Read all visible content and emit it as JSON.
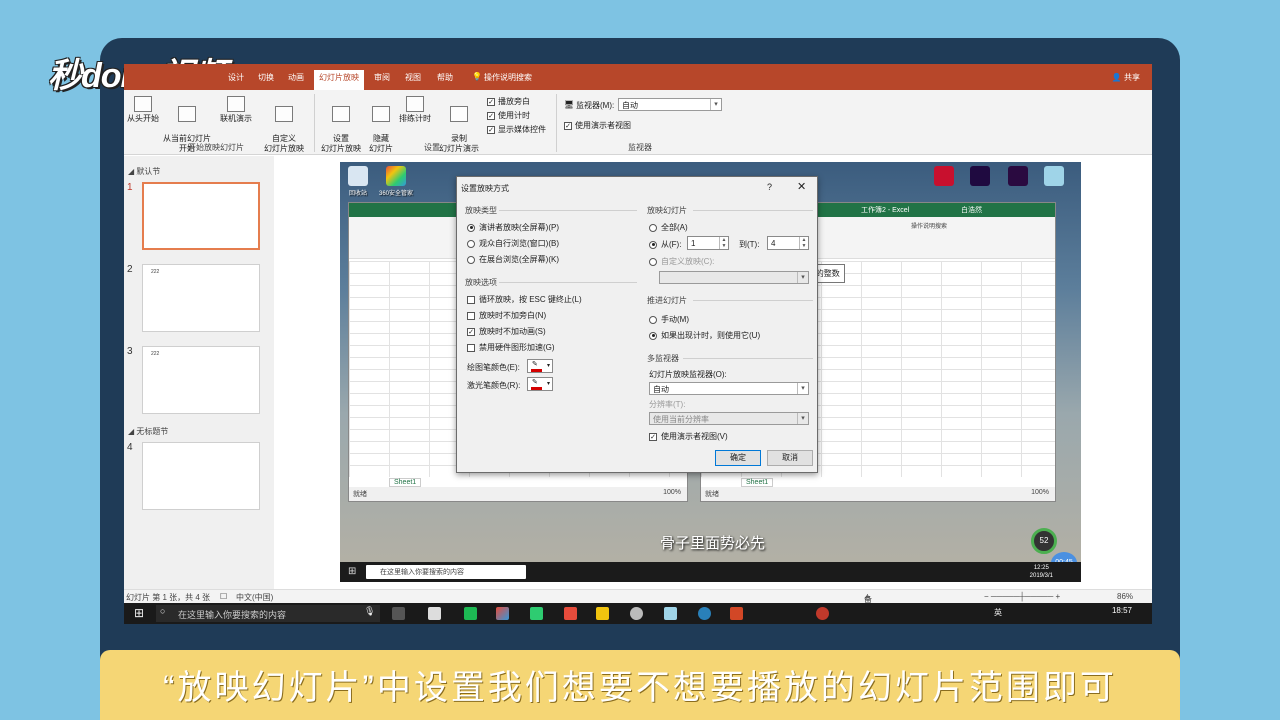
{
  "brand": {
    "logo_text": "秒dong视频"
  },
  "ribbon": {
    "tabs": [
      "设计",
      "切换",
      "动画",
      "幻灯片放映",
      "审阅",
      "视图",
      "帮助",
      "操作说明搜索"
    ],
    "share": "共享",
    "buttons": {
      "from_start": "从头开始",
      "from_current": "从当前幻灯片\n开始",
      "online": "联机演示",
      "custom": "自定义\n幻灯片放映",
      "setup": "设置\n幻灯片放映",
      "hide": "隐藏\n幻灯片",
      "rehearse": "排练计时",
      "record": "录制\n幻灯片演示"
    },
    "checks": [
      "播放旁白",
      "使用计时",
      "显示媒体控件"
    ],
    "monitor_label": "监视器(M):",
    "monitor_value": "自动",
    "presenter_view": "使用演示者视图",
    "groups": [
      "开始放映幻灯片",
      "设置",
      "监视器"
    ]
  },
  "thumbnails": {
    "section1": "默认节",
    "section2": "无标题节",
    "numbers": [
      "1",
      "2",
      "3",
      "4"
    ],
    "slide_texts": [
      "222",
      "222"
    ]
  },
  "slide": {
    "excel_left_title": "",
    "excel_right_title": "工作簿2 - Excel",
    "excel_right_user": "白浩然",
    "excel_right_search": "操作说明搜索",
    "sheet_tab": "Sheet1",
    "status_ready": "就绪",
    "zoom": "100%",
    "tooltip": "输入从 1 到 4 的整数",
    "caption": "骨子里面势必先",
    "taskbar_search": "在这里输入你要搜索的内容",
    "taskbar_time": "12:25",
    "taskbar_date": "2019/3/1",
    "badge_time": "00:45",
    "gauge": "52",
    "desktop_labels": [
      "回收站",
      "360安全管家"
    ]
  },
  "dialog": {
    "title": "设置放映方式",
    "help": "?",
    "close": "✕",
    "show_type": {
      "label": "放映类型",
      "options": [
        "演讲者放映(全屏幕)(P)",
        "观众自行浏览(窗口)(B)",
        "在展台浏览(全屏幕)(K)"
      ],
      "selected": 0
    },
    "show_options": {
      "label": "放映选项",
      "options": [
        "循环放映，按 ESC 键终止(L)",
        "放映时不加旁白(N)",
        "放映时不加动画(S)",
        "禁用硬件图形加速(G)"
      ],
      "checked": [
        false,
        false,
        true,
        false
      ],
      "pen_color": "绘图笔颜色(E):",
      "laser_color": "激光笔颜色(R):"
    },
    "slides": {
      "label": "放映幻灯片",
      "all": "全部(A)",
      "from": "从(F):",
      "from_value": "1",
      "to": "到(T):",
      "to_value": "4",
      "custom": "自定义放映(C):"
    },
    "advance": {
      "label": "推进幻灯片",
      "manual": "手动(M)",
      "timed": "如果出现计时，则使用它(U)"
    },
    "monitors": {
      "label": "多监视器",
      "monitor_label": "幻灯片放映监视器(O):",
      "monitor_value": "自动",
      "resolution_label": "分辨率(T):",
      "resolution_value": "使用当前分辨率",
      "presenter_view": "使用演示者视图(V)"
    },
    "ok": "确定",
    "cancel": "取消"
  },
  "statusbar": {
    "slide_info": "幻灯片 第 1 张，共 4 张",
    "language": "中文(中国)",
    "notes": "备注",
    "zoom": "86%"
  },
  "taskbar": {
    "search": "在这里输入你要搜索的内容",
    "time": "18:57",
    "lang": "英"
  },
  "caption": "“放映幻灯片”中设置我们想要不想要播放的幻灯片范围即可",
  "colors": {
    "ppt_accent": "#b7472a",
    "excel_accent": "#217346",
    "frame": "#1f3b57",
    "caption_bg": "#f5d675"
  }
}
